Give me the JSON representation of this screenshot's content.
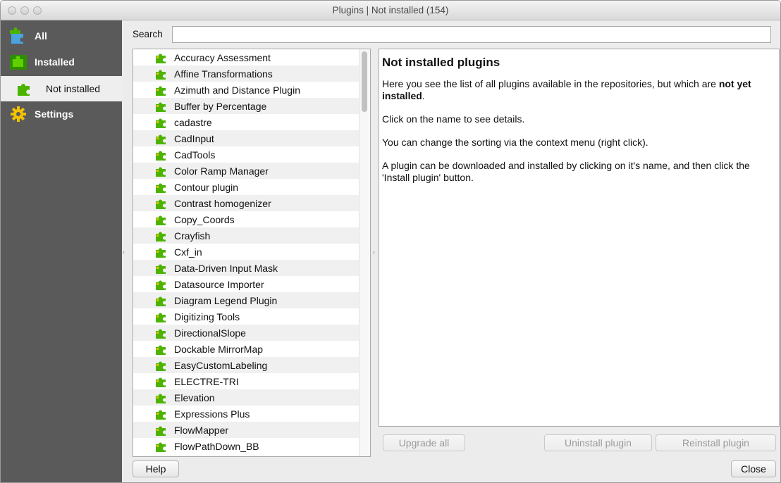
{
  "window": {
    "title": "Plugins | Not installed (154)"
  },
  "sidebar": {
    "items": [
      {
        "label": "All",
        "icon": "puzzle-all-icon"
      },
      {
        "label": "Installed",
        "icon": "puzzle-installed-icon"
      },
      {
        "label": "Not installed",
        "icon": "puzzle-not-installed-icon",
        "selected": true
      },
      {
        "label": "Settings",
        "icon": "gear-icon"
      }
    ]
  },
  "search": {
    "label": "Search",
    "value": ""
  },
  "plugins": [
    "Accuracy Assessment",
    "Affine Transformations",
    "Azimuth and Distance Plugin",
    "Buffer by Percentage",
    "cadastre",
    "CadInput",
    "CadTools",
    "Color Ramp Manager",
    "Contour plugin",
    "Contrast homogenizer",
    "Copy_Coords",
    "Crayfish",
    "Cxf_in",
    "Data-Driven Input Mask",
    "Datasource Importer",
    "Diagram Legend Plugin",
    "Digitizing Tools",
    "DirectionalSlope",
    "Dockable MirrorMap",
    "EasyCustomLabeling",
    "ELECTRE-TRI",
    "Elevation",
    "Expressions Plus",
    "FlowMapper",
    "FlowPathDown_BB"
  ],
  "details": {
    "heading": "Not installed plugins",
    "p1_text": "Here you see the list of all plugins available in the repositories, but which are ",
    "p1_bold": "not yet installed",
    "p1_end": ".",
    "p2": "Click on the name to see details.",
    "p3": "You can change the sorting via the context menu (right click).",
    "p4": "A plugin can be downloaded and installed by clicking on it's name, and then click the 'Install plugin' button."
  },
  "buttons": {
    "upgrade_all": "Upgrade all",
    "uninstall": "Uninstall plugin",
    "reinstall": "Reinstall plugin",
    "help": "Help",
    "close": "Close"
  },
  "colors": {
    "sidebar": "#5a5a5a",
    "puzzle": "#4cb400",
    "puzzle_highlight": "#f0c000"
  }
}
